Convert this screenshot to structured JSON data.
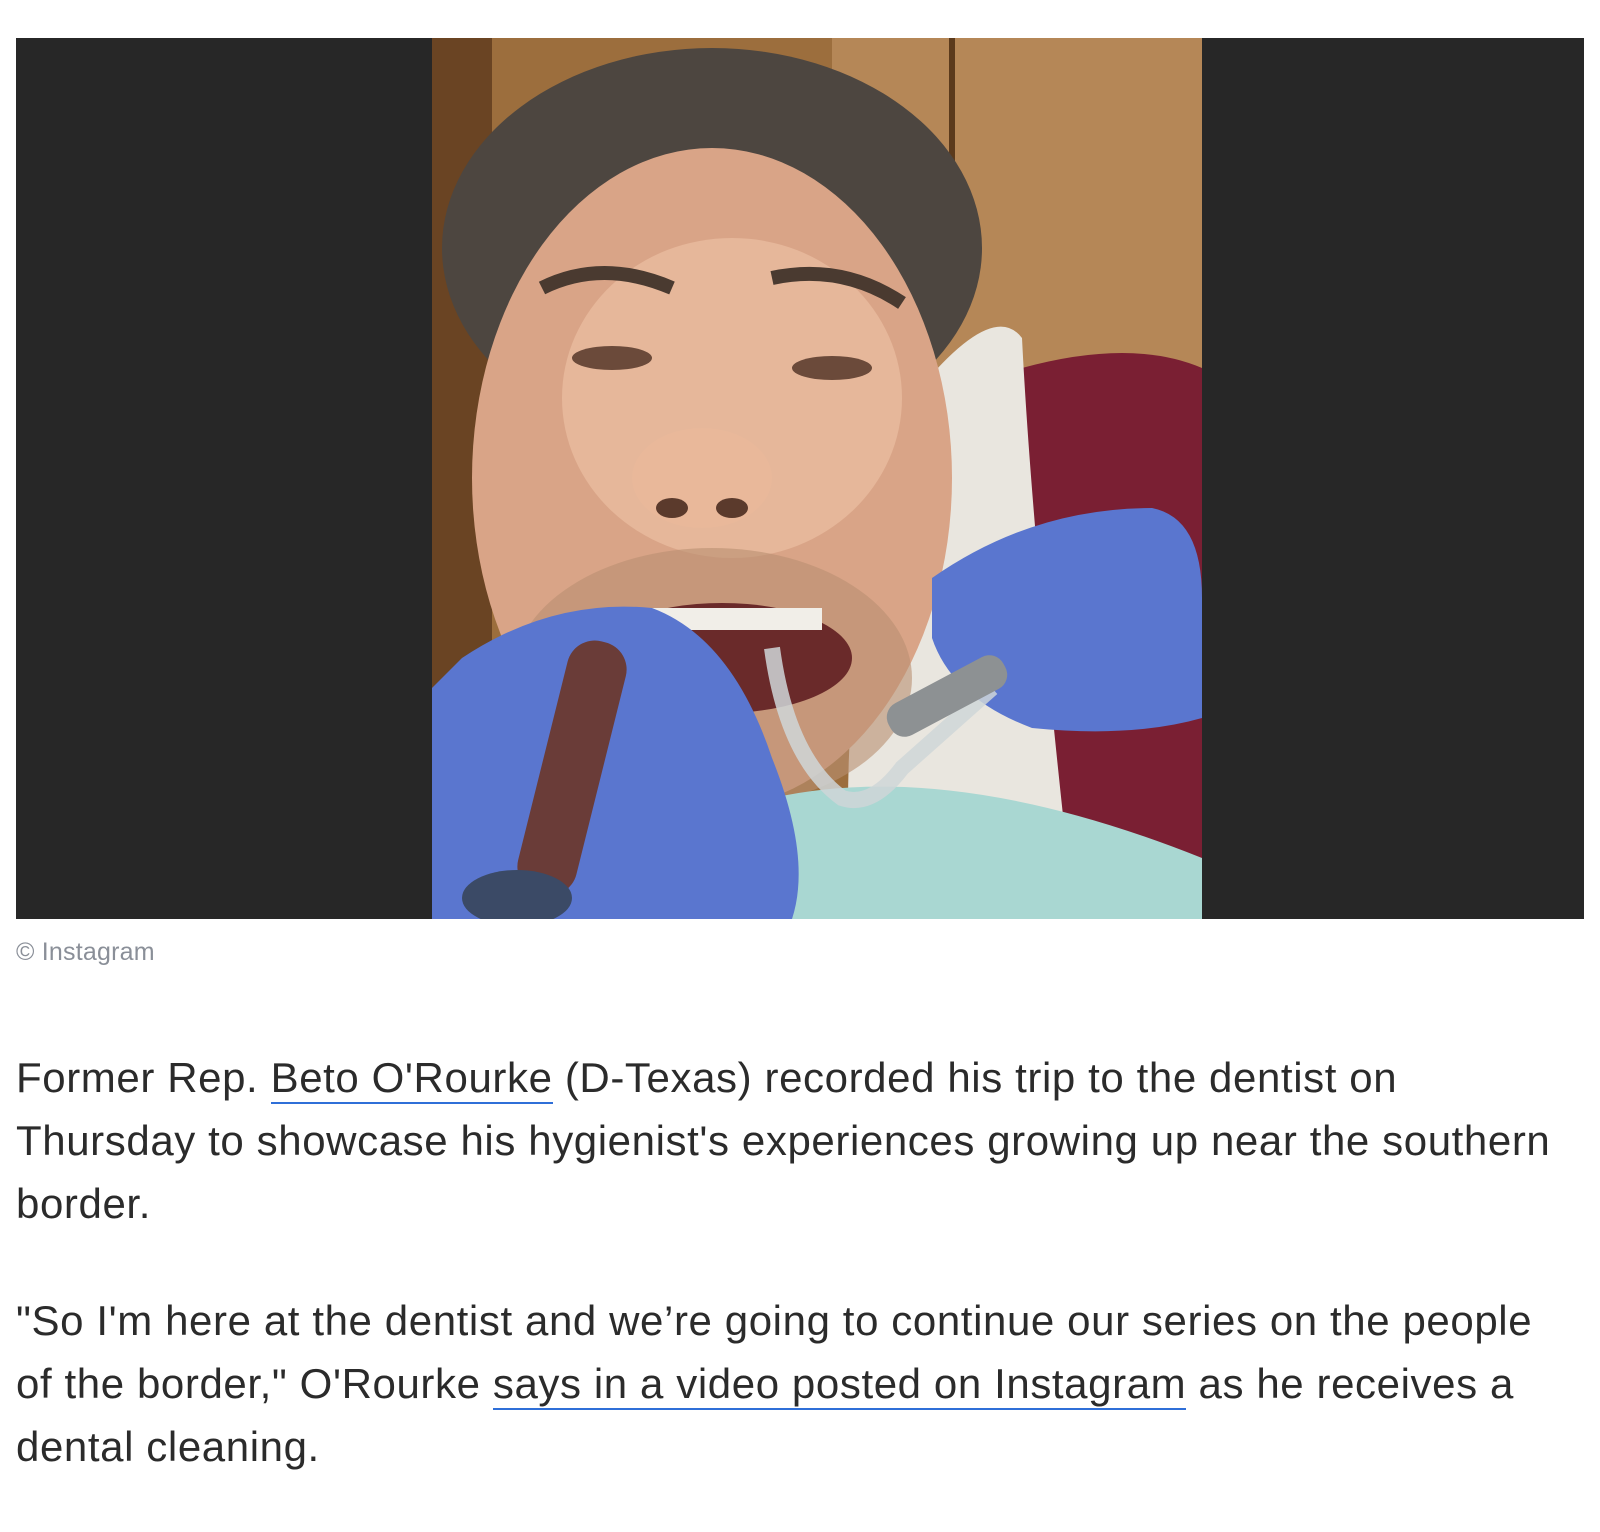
{
  "figure": {
    "credit": "© Instagram",
    "image_alt_icon": "dentist-selfie-photo"
  },
  "article": {
    "p1_before": "Former Rep. ",
    "p1_link": "Beto O'Rourke",
    "p1_after": " (D-Texas) recorded his trip to the dentist on Thursday to showcase his hygienist's experiences growing up near the southern border.",
    "p2_before": "\"So I'm here at the dentist and we’re going to continue our series on the people of the border,\" O'Rourke ",
    "p2_link": "says in a video posted on Instagram",
    "p2_after": " as he receives a dental cleaning."
  },
  "colors": {
    "link_underline": "#2f6fd8",
    "frame_background": "#272727",
    "credit_text": "#8a8f98"
  }
}
